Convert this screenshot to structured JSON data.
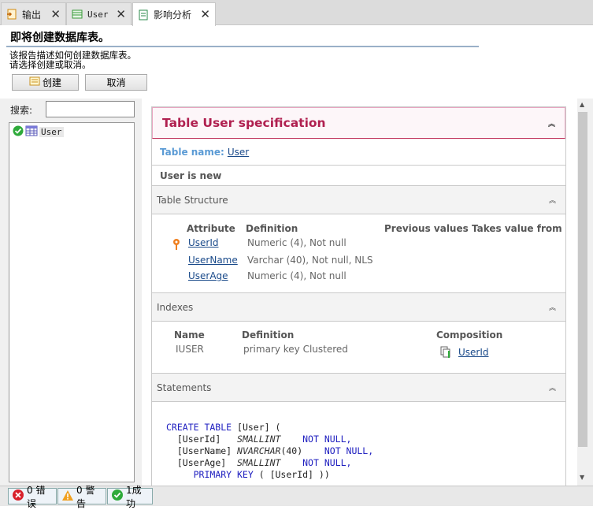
{
  "tabs": [
    {
      "label": "输出",
      "icon": "output-icon"
    },
    {
      "label": "User",
      "icon": "table-icon"
    },
    {
      "label": "影响分析",
      "icon": "analysis-icon"
    }
  ],
  "header": {
    "title": "即将创建数据库表。",
    "desc_line1": "该报告描述如何创建数据库表。",
    "desc_line2": "请选择创建或取消。",
    "create_label": "创建",
    "cancel_label": "取消"
  },
  "search": {
    "label": "搜索:",
    "value": ""
  },
  "tree": {
    "items": [
      {
        "label": "User"
      }
    ]
  },
  "spec": {
    "title": "Table User specification",
    "table_name_label": "Table name:",
    "table_name": "User",
    "is_new": "User is new",
    "structure": {
      "title": "Table Structure",
      "headers": [
        "Attribute",
        "Definition",
        "Previous values",
        "Takes value from"
      ],
      "rows": [
        {
          "attribute": "UserId",
          "definition": "Numeric (4), Not null",
          "key": true
        },
        {
          "attribute": "UserName",
          "definition": "Varchar (40), Not null, NLS",
          "key": false
        },
        {
          "attribute": "UserAge",
          "definition": "Numeric (4), Not null",
          "key": false
        }
      ]
    },
    "indexes": {
      "title": "Indexes",
      "headers": [
        "Name",
        "Definition",
        "Composition"
      ],
      "rows": [
        {
          "name": "IUSER",
          "definition": "primary key Clustered",
          "composition": "UserId"
        }
      ]
    },
    "statements": {
      "title": "Statements",
      "code": [
        [
          "CREATE TABLE",
          "[User] ("
        ],
        [
          "[UserId]",
          "SMALLINT",
          "NOT NULL,"
        ],
        [
          "[UserName]",
          "NVARCHAR",
          "(40)",
          "NOT NULL,"
        ],
        [
          "[UserAge]",
          "SMALLINT",
          "NOT NULL,"
        ],
        [
          "PRIMARY KEY",
          "( [UserId] ))"
        ]
      ]
    }
  },
  "status": {
    "errors": "0 错误",
    "warnings": "0 警告",
    "success": "1成功"
  },
  "colors": {
    "accent": "#b02050",
    "link": "#1a4a8a",
    "keyword": "#2020c0"
  }
}
